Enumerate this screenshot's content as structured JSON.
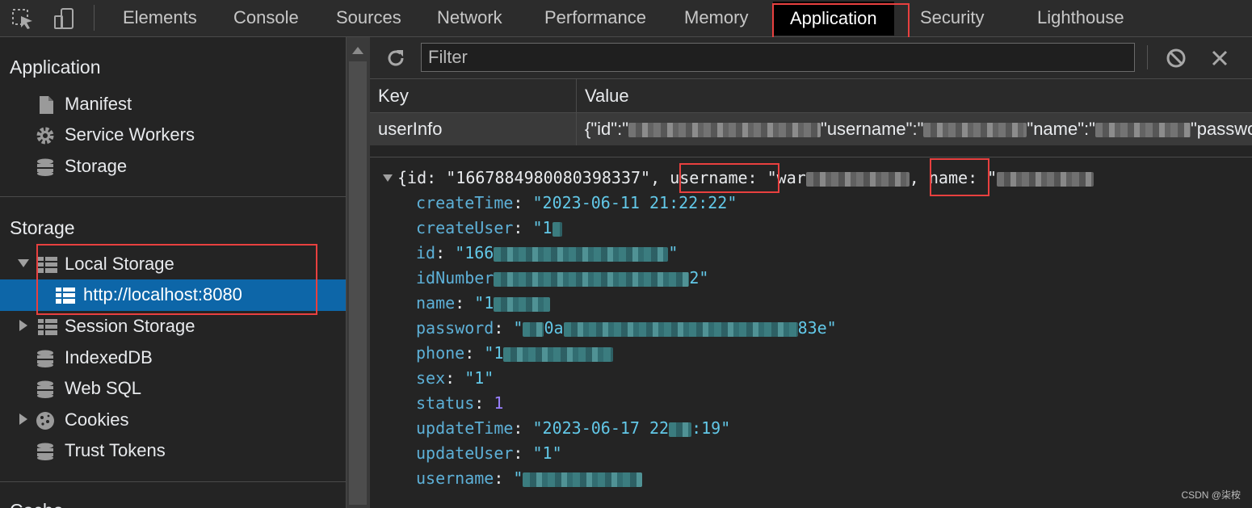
{
  "tabs": [
    "Elements",
    "Console",
    "Sources",
    "Network",
    "Performance",
    "Memory",
    "Application",
    "Security",
    "Lighthouse"
  ],
  "active_tab": "Application",
  "sidebar": {
    "application_title": "Application",
    "application_items": [
      {
        "label": "Manifest",
        "icon": "file-icon"
      },
      {
        "label": "Service Workers",
        "icon": "gear-icon"
      },
      {
        "label": "Storage",
        "icon": "database-icon"
      }
    ],
    "storage_title": "Storage",
    "storage_items": [
      {
        "label": "Local Storage",
        "icon": "table-icon",
        "expanded": true
      },
      {
        "label": "http://localhost:8080",
        "icon": "table-icon",
        "selected": true
      },
      {
        "label": "Session Storage",
        "icon": "table-icon",
        "expanded": false
      },
      {
        "label": "IndexedDB",
        "icon": "database-icon"
      },
      {
        "label": "Web SQL",
        "icon": "database-icon"
      },
      {
        "label": "Cookies",
        "icon": "cookie-icon",
        "expanded": false
      },
      {
        "label": "Trust Tokens",
        "icon": "database-icon"
      }
    ],
    "cache_title_partial": "Cache"
  },
  "toolbar": {
    "filter_placeholder": "Filter"
  },
  "table": {
    "headers": [
      "Key",
      "Value"
    ],
    "row": {
      "key": "userInfo",
      "value_parts": [
        "{\"id\":\"",
        "\"username\":\"",
        "\"name\":\"",
        "\"passwo"
      ]
    }
  },
  "preview": {
    "summary": {
      "id_key": "id",
      "id_value": "\"1667884980080398337\"",
      "username_key": "username",
      "username_value_prefix": "\"war",
      "name_key": "name",
      "name_value_prefix": "\""
    },
    "fields": {
      "createTime": {
        "key": "createTime",
        "value": "\"2023-06-11 21:22:22\""
      },
      "createUser": {
        "key": "createUser",
        "value_prefix": "\"1"
      },
      "id": {
        "key": "id",
        "value_prefix": "\"166",
        "value_suffix": "\""
      },
      "idNumber": {
        "key": "idNumber",
        "value_suffix": "2\""
      },
      "name": {
        "key": "name",
        "value_prefix": "\"1"
      },
      "password": {
        "key": "password",
        "value_prefix": "\"",
        "value_mid": "0a",
        "value_suffix": "83e\""
      },
      "phone": {
        "key": "phone",
        "value_prefix": "\"1"
      },
      "sex": {
        "key": "sex",
        "value": "\"1\""
      },
      "status": {
        "key": "status",
        "value": "1"
      },
      "updateTime": {
        "key": "updateTime",
        "value_prefix": "\"2023-06-17 22",
        "value_suffix": ":19\""
      },
      "updateUser": {
        "key": "updateUser",
        "value": "\"1\""
      },
      "username": {
        "key": "username",
        "value_prefix": "\""
      }
    }
  },
  "watermark": "CSDN @柒桉",
  "colors": {
    "annotation_red": "#e8403f",
    "selection_blue": "#0d66a8",
    "string_teal": "#62c8e8",
    "key_blue": "#5db0d7",
    "number_purple": "#9980ff"
  }
}
